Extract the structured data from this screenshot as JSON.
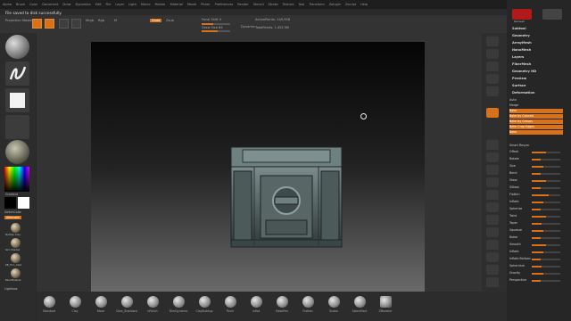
{
  "menubar": [
    "Alpha",
    "Brush",
    "Color",
    "Document",
    "Draw",
    "Dynamics",
    "Edit",
    "File",
    "Layer",
    "Light",
    "Macro",
    "Marker",
    "Material",
    "Movie",
    "Picker",
    "Preferences",
    "Render",
    "Stencil",
    "Stroke",
    "Texture",
    "Tool",
    "Transform",
    "Zplugin",
    "Zscript",
    "Help"
  ],
  "notice": "File saved to disk successfully.",
  "toolbar": {
    "projection": "Projection Master",
    "edit": "Edit",
    "draw": "Draw",
    "move": "Move",
    "scale": "Scale",
    "rotate": "Rotate",
    "mrgb": "Mrgb",
    "rgb": "Rgb",
    "m": "M",
    "zadd": "Zadd",
    "zsub": "Zsub",
    "focal_shift": "Focal Shift 0",
    "draw_size": "Draw Size 64",
    "dynamic": "Dynamic",
    "active_points": "ActivePoints: 149,958",
    "total_points": "TotalPoints: 1.452 Mil",
    "draw_size_level": 0.55,
    "focal_shift_level": 0.4
  },
  "left": {
    "gradient": "Gradient",
    "switch_color": "SwitchColor",
    "alternate": "Alternate",
    "lightbox": "Lightbox",
    "materials": [
      "MatCap Gray",
      "Skin Shade4",
      "ZB_Thin_Lite2",
      "BasicMaterial"
    ]
  },
  "right": {
    "top_label": "Remesh",
    "sections": [
      "Subtool",
      "Geometry",
      "ArrayMesh",
      "NanoMesh",
      "Layers",
      "FiberMesh",
      "Geometry HD",
      "Preview",
      "Surface",
      "Deformation"
    ],
    "list_header": "Auto",
    "list": [
      "Merge",
      "Bake",
      "Bake by Colored",
      "Bake by Groups",
      "Bake Crop Edges",
      "Bake"
    ],
    "outline": "Smart Resym",
    "sliders": [
      {
        "label": "Offset",
        "value": 0.5
      },
      {
        "label": "Rotate",
        "value": 0.3
      },
      {
        "label": "Size",
        "value": 0.4
      },
      {
        "label": "Bend",
        "value": 0.3
      },
      {
        "label": "Skew",
        "value": 0.5
      },
      {
        "label": "SSkew",
        "value": 0.3
      },
      {
        "label": "Flatten",
        "value": 0.6
      },
      {
        "label": "Inflate",
        "value": 0.4
      },
      {
        "label": "Spherize",
        "value": 0.3
      },
      {
        "label": "Twist",
        "value": 0.5
      },
      {
        "label": "Taper",
        "value": 0.35
      },
      {
        "label": "Squeeze",
        "value": 0.4
      },
      {
        "label": "Noise",
        "value": 0.3
      },
      {
        "label": "Smooth",
        "value": 0.5
      },
      {
        "label": "Inflate",
        "value": 0.4
      },
      {
        "label": "Inflate Balloon",
        "value": 0.3
      },
      {
        "label": "Sphericize",
        "value": 0.35
      },
      {
        "label": "Gravity",
        "value": 0.4
      },
      {
        "label": "Perspective",
        "value": 0.3
      }
    ]
  },
  "bottom_brushes": [
    "Standard",
    "Clay",
    "Move",
    "Dam_Standard",
    "hPolish",
    "TrimDynamic",
    "ClayBuildup",
    "Pinch",
    "Inflat",
    "MaskPen",
    "Flatten",
    "Snake",
    "SelectRect",
    "ZModeler"
  ]
}
